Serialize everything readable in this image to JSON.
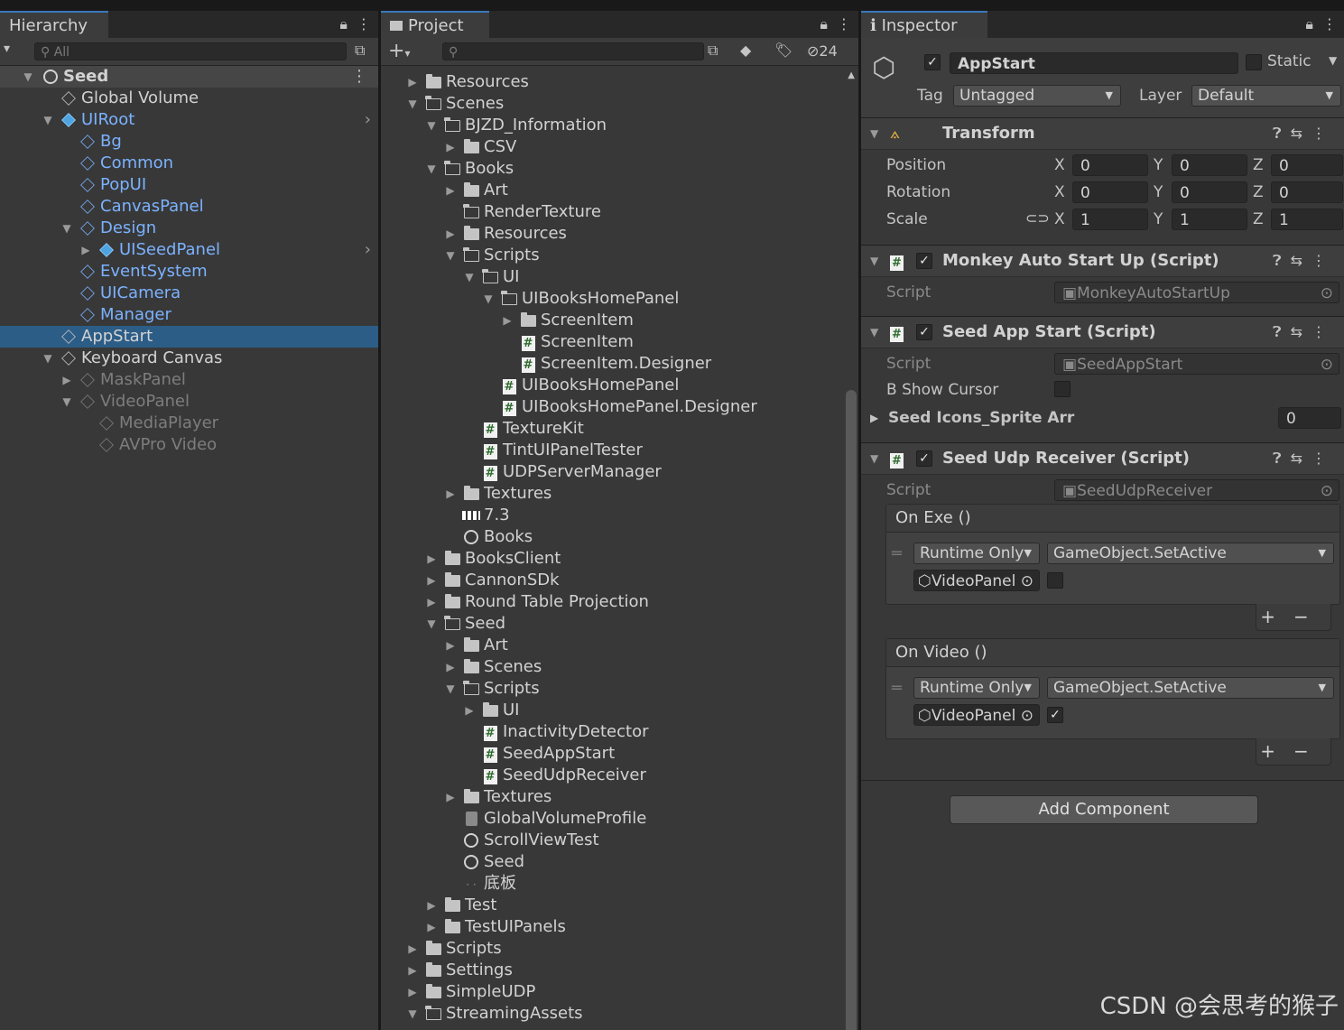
{
  "hierarchy": {
    "tab": "Hierarchy",
    "search_placeholder": "All",
    "scene": "Seed",
    "items": [
      {
        "label": "Global Volume",
        "depth": 1,
        "arrow": "",
        "icon": "cube",
        "color": "white"
      },
      {
        "label": "UIRoot",
        "depth": 1,
        "arrow": "down",
        "icon": "prefab",
        "color": "blue",
        "more": true
      },
      {
        "label": "Bg",
        "depth": 2,
        "arrow": "",
        "icon": "cube",
        "color": "blue"
      },
      {
        "label": "Common",
        "depth": 2,
        "arrow": "",
        "icon": "cube",
        "color": "blue"
      },
      {
        "label": "PopUI",
        "depth": 2,
        "arrow": "",
        "icon": "cube",
        "color": "blue"
      },
      {
        "label": "CanvasPanel",
        "depth": 2,
        "arrow": "",
        "icon": "cube",
        "color": "blue"
      },
      {
        "label": "Design",
        "depth": 2,
        "arrow": "down",
        "icon": "cube",
        "color": "blue"
      },
      {
        "label": "UISeedPanel",
        "depth": 3,
        "arrow": "right",
        "icon": "prefab",
        "color": "blue",
        "more": true
      },
      {
        "label": "EventSystem",
        "depth": 2,
        "arrow": "",
        "icon": "cube",
        "color": "blue"
      },
      {
        "label": "UICamera",
        "depth": 2,
        "arrow": "",
        "icon": "cube",
        "color": "blue"
      },
      {
        "label": "Manager",
        "depth": 2,
        "arrow": "",
        "icon": "cube",
        "color": "blue"
      },
      {
        "label": "AppStart",
        "depth": 1,
        "arrow": "",
        "icon": "cube",
        "color": "white",
        "selected": true
      },
      {
        "label": "Keyboard Canvas",
        "depth": 1,
        "arrow": "down",
        "icon": "cube",
        "color": "white"
      },
      {
        "label": "MaskPanel",
        "depth": 2,
        "arrow": "right",
        "icon": "cube",
        "color": "grey"
      },
      {
        "label": "VideoPanel",
        "depth": 2,
        "arrow": "down",
        "icon": "cube",
        "color": "grey"
      },
      {
        "label": "MediaPlayer",
        "depth": 3,
        "arrow": "",
        "icon": "cube",
        "color": "grey"
      },
      {
        "label": "AVPro Video",
        "depth": 3,
        "arrow": "",
        "icon": "cube",
        "color": "grey"
      }
    ]
  },
  "project": {
    "tab": "Project",
    "hidden_count": "24",
    "items": [
      {
        "label": "Resources",
        "depth": 1,
        "arrow": "right",
        "icon": "folder"
      },
      {
        "label": "Scenes",
        "depth": 1,
        "arrow": "down",
        "icon": "folder-open"
      },
      {
        "label": "BJZD_Information",
        "depth": 2,
        "arrow": "down",
        "icon": "folder-open"
      },
      {
        "label": "CSV",
        "depth": 3,
        "arrow": "right",
        "icon": "folder"
      },
      {
        "label": "Books",
        "depth": 2,
        "arrow": "down",
        "icon": "folder-open"
      },
      {
        "label": "Art",
        "depth": 3,
        "arrow": "right",
        "icon": "folder"
      },
      {
        "label": "RenderTexture",
        "depth": 3,
        "arrow": "",
        "icon": "folder-open"
      },
      {
        "label": "Resources",
        "depth": 3,
        "arrow": "right",
        "icon": "folder"
      },
      {
        "label": "Scripts",
        "depth": 3,
        "arrow": "down",
        "icon": "folder-open"
      },
      {
        "label": "UI",
        "depth": 4,
        "arrow": "down",
        "icon": "folder-open"
      },
      {
        "label": "UIBooksHomePanel",
        "depth": 5,
        "arrow": "down",
        "icon": "folder-open"
      },
      {
        "label": "ScreenItem",
        "depth": 6,
        "arrow": "right",
        "icon": "folder"
      },
      {
        "label": "ScreenItem",
        "depth": 6,
        "arrow": "",
        "icon": "cs"
      },
      {
        "label": "ScreenItem.Designer",
        "depth": 6,
        "arrow": "",
        "icon": "cs"
      },
      {
        "label": "UIBooksHomePanel",
        "depth": 5,
        "arrow": "",
        "icon": "cs"
      },
      {
        "label": "UIBooksHomePanel.Designer",
        "depth": 5,
        "arrow": "",
        "icon": "cs"
      },
      {
        "label": "TextureKit",
        "depth": 4,
        "arrow": "",
        "icon": "cs"
      },
      {
        "label": "TintUIPanelTester",
        "depth": 4,
        "arrow": "",
        "icon": "cs"
      },
      {
        "label": "UDPServerManager",
        "depth": 4,
        "arrow": "",
        "icon": "cs"
      },
      {
        "label": "Textures",
        "depth": 3,
        "arrow": "right",
        "icon": "folder"
      },
      {
        "label": "7.3",
        "depth": 3,
        "arrow": "",
        "icon": "image"
      },
      {
        "label": "Books",
        "depth": 3,
        "arrow": "",
        "icon": "unity"
      },
      {
        "label": "BooksClient",
        "depth": 2,
        "arrow": "right",
        "icon": "folder"
      },
      {
        "label": "CannonSDk",
        "depth": 2,
        "arrow": "right",
        "icon": "folder"
      },
      {
        "label": "Round Table Projection",
        "depth": 2,
        "arrow": "right",
        "icon": "folder"
      },
      {
        "label": "Seed",
        "depth": 2,
        "arrow": "down",
        "icon": "folder-open"
      },
      {
        "label": "Art",
        "depth": 3,
        "arrow": "right",
        "icon": "folder"
      },
      {
        "label": "Scenes",
        "depth": 3,
        "arrow": "right",
        "icon": "folder"
      },
      {
        "label": "Scripts",
        "depth": 3,
        "arrow": "down",
        "icon": "folder-open"
      },
      {
        "label": "UI",
        "depth": 4,
        "arrow": "right",
        "icon": "folder"
      },
      {
        "label": "InactivityDetector",
        "depth": 4,
        "arrow": "",
        "icon": "cs"
      },
      {
        "label": "SeedAppStart",
        "depth": 4,
        "arrow": "",
        "icon": "cs"
      },
      {
        "label": "SeedUdpReceiver",
        "depth": 4,
        "arrow": "",
        "icon": "cs"
      },
      {
        "label": "Textures",
        "depth": 3,
        "arrow": "right",
        "icon": "folder"
      },
      {
        "label": "GlobalVolumeProfile",
        "depth": 3,
        "arrow": "",
        "icon": "asset"
      },
      {
        "label": "ScrollViewTest",
        "depth": 3,
        "arrow": "",
        "icon": "unity"
      },
      {
        "label": "Seed",
        "depth": 3,
        "arrow": "",
        "icon": "unity"
      },
      {
        "label": "底板",
        "depth": 3,
        "arrow": "",
        "icon": "dots"
      },
      {
        "label": "Test",
        "depth": 2,
        "arrow": "right",
        "icon": "folder"
      },
      {
        "label": "TestUIPanels",
        "depth": 2,
        "arrow": "right",
        "icon": "folder"
      },
      {
        "label": "Scripts",
        "depth": 1,
        "arrow": "right",
        "icon": "folder"
      },
      {
        "label": "Settings",
        "depth": 1,
        "arrow": "right",
        "icon": "folder"
      },
      {
        "label": "SimpleUDP",
        "depth": 1,
        "arrow": "right",
        "icon": "folder"
      },
      {
        "label": "StreamingAssets",
        "depth": 1,
        "arrow": "down",
        "icon": "folder-open"
      }
    ]
  },
  "inspector": {
    "tab": "Inspector",
    "object_name": "AppStart",
    "static_label": "Static",
    "tag_label": "Tag",
    "tag_value": "Untagged",
    "layer_label": "Layer",
    "layer_value": "Default",
    "transform": {
      "title": "Transform",
      "position_label": "Position",
      "rotation_label": "Rotation",
      "scale_label": "Scale",
      "position": {
        "x": "0",
        "y": "0",
        "z": "0"
      },
      "rotation": {
        "x": "0",
        "y": "0",
        "z": "0"
      },
      "scale": {
        "x": "1",
        "y": "1",
        "z": "1"
      }
    },
    "comp1": {
      "title": "Monkey Auto Start Up (Script)",
      "script_label": "Script",
      "script_value": "MonkeyAutoStartUp"
    },
    "comp2": {
      "title": "Seed App Start (Script)",
      "script_label": "Script",
      "script_value": "SeedAppStart",
      "show_cursor_label": "B Show Cursor",
      "sprite_label": "Seed Icons_Sprite Arr",
      "sprite_count": "0"
    },
    "comp3": {
      "title": "Seed Udp Receiver (Script)",
      "script_label": "Script",
      "script_value": "SeedUdpReceiver",
      "event1": {
        "title": "On Exe ()",
        "mode": "Runtime Only",
        "func": "GameObject.SetActive",
        "target": "VideoPanel",
        "checked": false
      },
      "event2": {
        "title": "On Video ()",
        "mode": "Runtime Only",
        "func": "GameObject.SetActive",
        "target": "VideoPanel",
        "checked": true
      }
    },
    "add_component": "Add Component"
  },
  "watermark": "CSDN @会思考的猴子"
}
